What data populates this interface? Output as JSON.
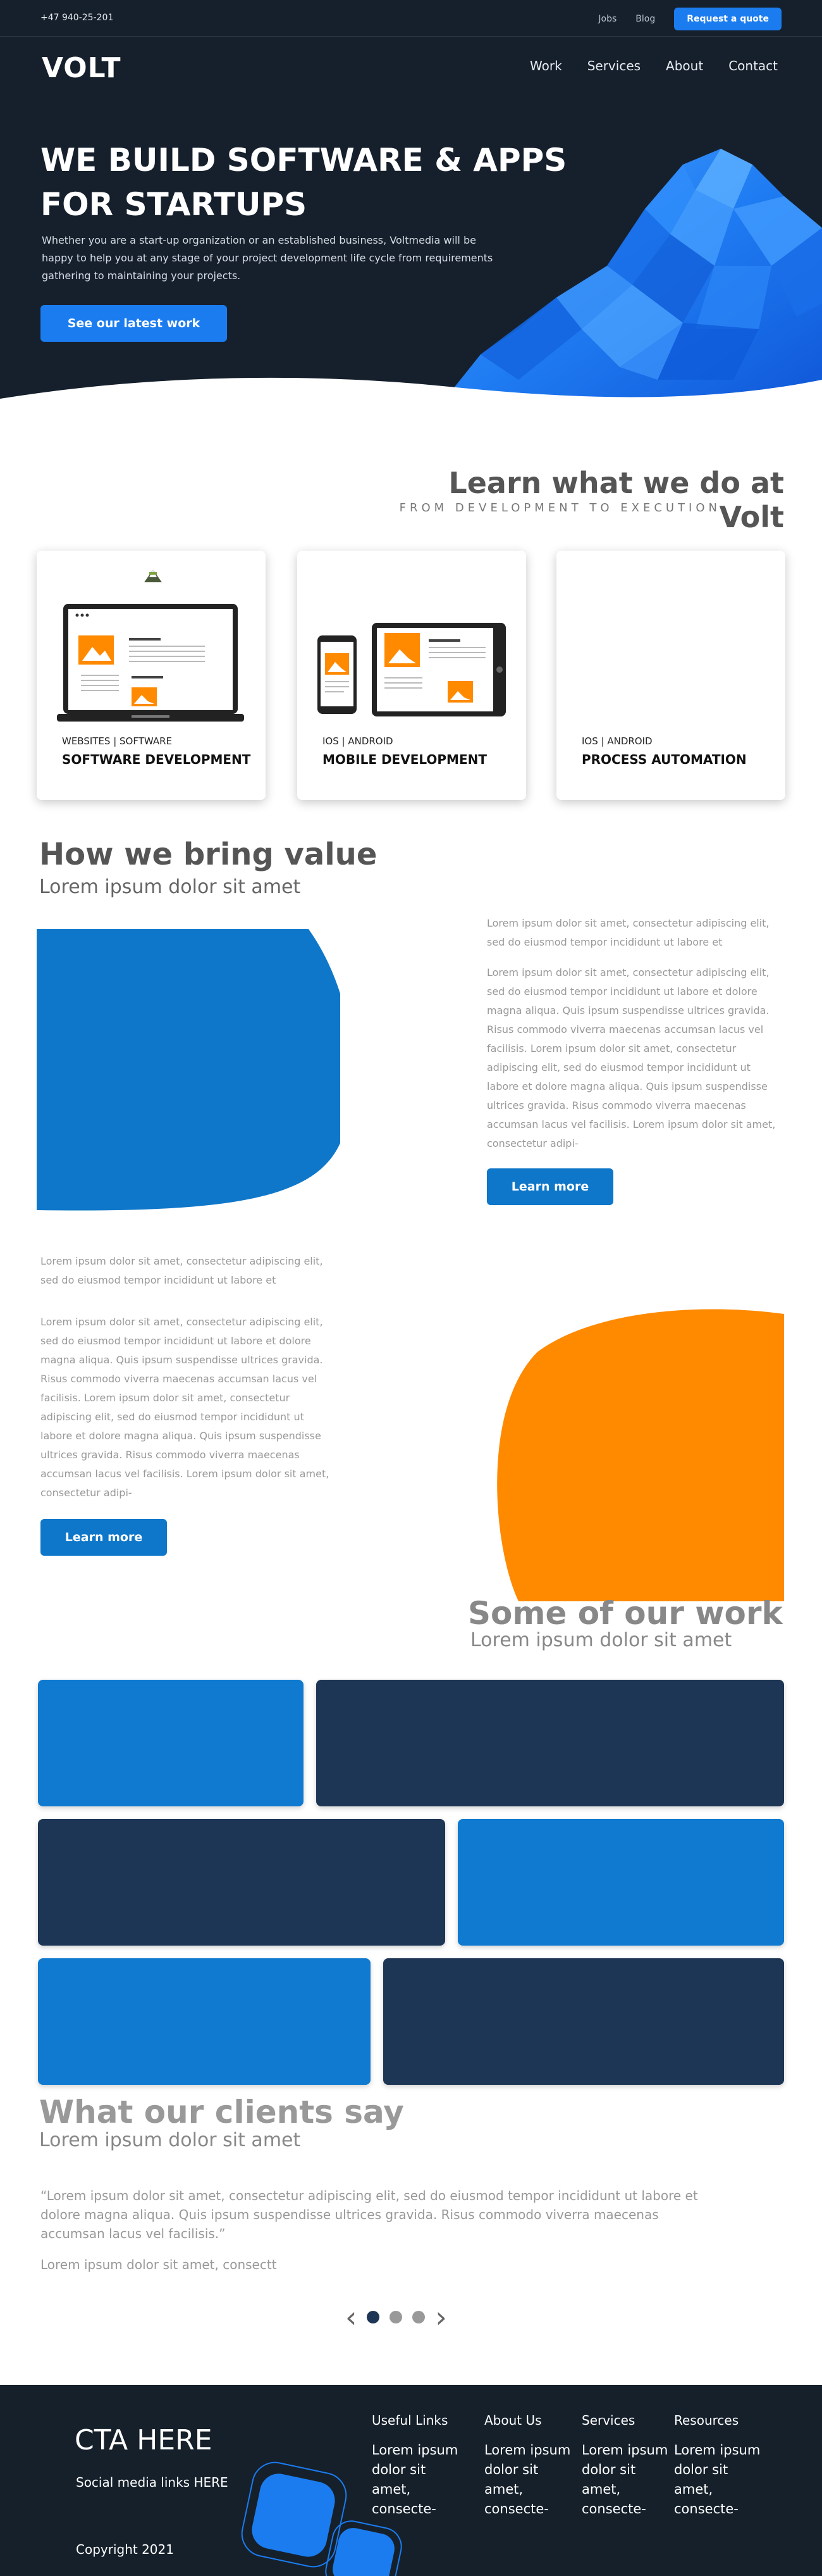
{
  "topbar": {
    "phone": "+47 940-25-201",
    "links": [
      "Jobs",
      "Blog"
    ],
    "quote_button": "Request a quote"
  },
  "brand": {
    "logo": "VOLT"
  },
  "nav": {
    "items": [
      "Work",
      "Services",
      "About",
      "Contact"
    ]
  },
  "hero": {
    "title": "WE BUILD SOFTWARE & APPS FOR STARTUPS",
    "description": "Whether you are a start-up organization or an established business, Voltmedia will be happy to help you at any stage of your project development life cycle from requirements gathering to maintaining your projects.",
    "button": "See our latest work"
  },
  "learn": {
    "title": "Learn what we do at Volt",
    "subtitle": "FROM DEVELOPMENT TO EXECUTION",
    "cards": [
      {
        "tag": "WEBSITES  |  SOFTWARE",
        "title": "SOFTWARE DEVELOPMENT",
        "icon": "laptop-icon"
      },
      {
        "tag": "IOS  |  ANDROID",
        "title": "MOBILE DEVELOPMENT",
        "icon": "devices-icon"
      },
      {
        "tag": "IOS  |  ANDROID",
        "title": "PROCESS AUTOMATION",
        "icon": ""
      }
    ]
  },
  "value": {
    "title": "How we bring value",
    "subtitle": "Lorem ipsum dolor sit amet",
    "block1": {
      "intro": "Lorem ipsum dolor sit amet, consectetur adipiscing elit, sed do eiusmod tempor incididunt ut labore et",
      "body": "Lorem ipsum dolor sit amet, consectetur adipiscing elit, sed do eiusmod tempor incididunt ut labore et dolore magna aliqua. Quis ipsum suspendisse ultrices gravida. Risus commodo viverra maecenas accumsan lacus vel facilisis. Lorem ipsum dolor sit amet, consectetur adipiscing elit, sed do eiusmod tempor incididunt ut labore et dolore magna aliqua. Quis ipsum suspendisse ultrices gravida. Risus commodo viverra maecenas accumsan lacus vel facilisis. Lorem ipsum dolor sit amet, consectetur adipi-",
      "button": "Learn more"
    },
    "block2": {
      "intro": "Lorem ipsum dolor sit amet, consectetur adipiscing elit, sed do eiusmod tempor incididunt ut labore et",
      "body": "Lorem ipsum dolor sit amet, consectetur adipiscing elit, sed do eiusmod tempor incididunt ut labore et dolore magna aliqua. Quis ipsum suspendisse ultrices gravida. Risus commodo viverra maecenas accumsan lacus vel facilisis. Lorem ipsum dolor sit amet, consectetur adipiscing elit, sed do eiusmod tempor incididunt ut labore et dolore magna aliqua. Quis ipsum suspendisse ultrices gravida. Risus commodo viverra maecenas accumsan lacus vel facilisis. Lorem ipsum dolor sit amet, consectetur adipi-",
      "button": "Learn more"
    }
  },
  "work": {
    "title": "Some of our work",
    "subtitle": "Lorem ipsum dolor sit amet"
  },
  "clients": {
    "title": "What our clients say",
    "subtitle": "Lorem ipsum dolor sit amet",
    "quote": "“Lorem ipsum dolor sit amet, consectetur adipiscing elit, sed do eiusmod tempor incididunt ut labore et dolore magna aliqua. Quis ipsum suspendisse ultrices gravida. Risus commodo viverra maecenas accumsan lacus vel facilisis.”",
    "author": "Lorem ipsum dolor sit amet, consectt",
    "prev_arrow": "‹",
    "next_arrow": "›"
  },
  "footer": {
    "cta": "CTA HERE",
    "social": "Social media links HERE",
    "copyright": "Copyright  2021",
    "columns": [
      {
        "heading": "Useful Links",
        "body": "Lorem ipsum dolor sit amet, consecte-"
      },
      {
        "heading": "About Us",
        "body": "Lorem ipsum dolor sit amet, consecte-"
      },
      {
        "heading": "Services",
        "body": "Lorem ipsum dolor sit amet, consecte-"
      },
      {
        "heading": "Resources",
        "body": "Lorem ipsum dolor sit amet, consecte-"
      }
    ]
  },
  "colors": {
    "navy": "#16202c",
    "primary_blue": "#1b7cf0",
    "secondary_blue": "#0f77c9",
    "tile_navy": "#1d3656",
    "orange": "#ff8a00"
  }
}
